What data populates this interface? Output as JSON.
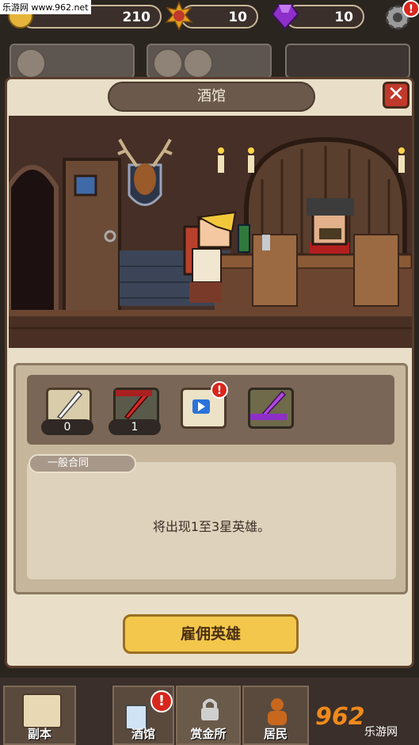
{
  "watermark": "乐游网 www.962.net",
  "resources": {
    "gold": "210",
    "medal": "10",
    "gem": "10"
  },
  "modal": {
    "title": "酒馆",
    "close_glyph": "✕",
    "cards": [
      {
        "type": "white-quill-scroll",
        "count": "0"
      },
      {
        "type": "red-quill-scroll",
        "count": "1"
      },
      {
        "type": "video-ad-scroll",
        "badge": "!"
      },
      {
        "type": "purple-quill-scroll"
      }
    ],
    "contract_tab": "一般合同",
    "description": "将出现1至3星英雄。",
    "hire_button": "雇佣英雄"
  },
  "nav": {
    "items": [
      {
        "label": "副本"
      },
      {
        "label": "酒馆",
        "badge": "!"
      },
      {
        "label": "赏金所"
      },
      {
        "label": "居民"
      }
    ],
    "logo": "962",
    "logo_sub": "乐游网"
  },
  "colors": {
    "modal_bg": "#e9dfc9",
    "hire_button": "#f3c74b",
    "close_button": "#c0392b",
    "badge": "#d9261c"
  }
}
